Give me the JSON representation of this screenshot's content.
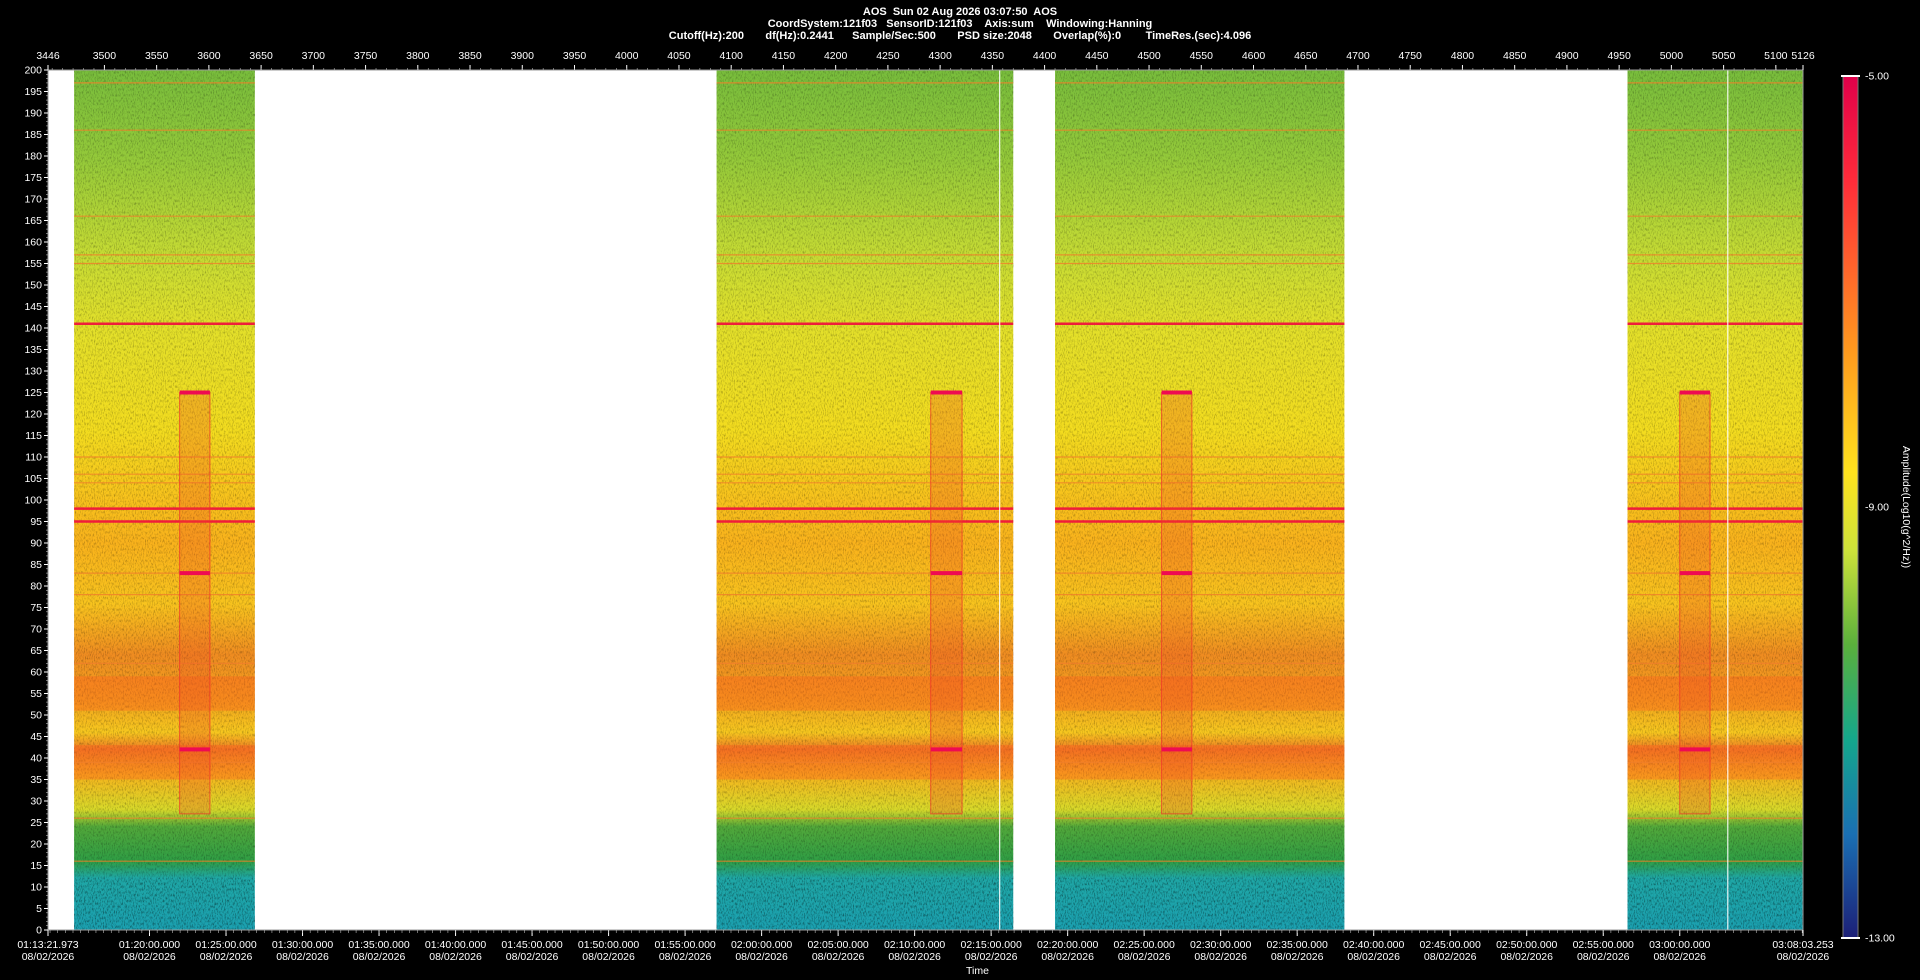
{
  "header": {
    "line1": "AOS  Sun 02 Aug 2026 03:07:50  AOS",
    "line2": "CoordSystem:121f03   SensorID:121f03    Axis:sum    Windowing:Hanning",
    "line3": "Cutoff(Hz):200       df(Hz):0.2441      Sample/Sec:500       PSD size:2048       Overlap(%):0        TimeRes.(sec):4.096"
  },
  "chart_data": {
    "type": "heatmap",
    "title": "",
    "ylabel": "",
    "xlabel": "Time",
    "colorbar_label": "Amplitude(Log10(g^2/Hz))",
    "colorbar_ticks": [
      "-5.00",
      "-9.00",
      "-13.00"
    ],
    "colorbar_range": [
      -13,
      -5
    ],
    "frequency_range": [
      0,
      200
    ],
    "y_ticks": [
      0,
      5,
      10,
      15,
      20,
      25,
      30,
      35,
      40,
      45,
      50,
      55,
      60,
      65,
      70,
      75,
      80,
      85,
      90,
      95,
      100,
      105,
      110,
      115,
      120,
      125,
      130,
      135,
      140,
      145,
      150,
      155,
      160,
      165,
      170,
      175,
      180,
      185,
      190,
      195,
      200
    ],
    "sample_axis_range": [
      3446,
      5126
    ],
    "sample_ticks": [
      "3446",
      "3500",
      "3550",
      "3600",
      "3650",
      "3700",
      "3750",
      "3800",
      "3850",
      "3900",
      "3950",
      "4000",
      "4050",
      "4100",
      "4150",
      "4200",
      "4250",
      "4300",
      "4350",
      "4400",
      "4450",
      "4500",
      "4550",
      "4600",
      "4650",
      "4700",
      "4750",
      "4800",
      "4850",
      "4900",
      "4950",
      "5000",
      "5050",
      "5100",
      "5126"
    ],
    "time_ticks": [
      {
        "time": "01:13:21.973",
        "date": "08/02/2026"
      },
      {
        "time": "01:20:00.000",
        "date": "08/02/2026"
      },
      {
        "time": "01:25:00.000",
        "date": "08/02/2026"
      },
      {
        "time": "01:30:00.000",
        "date": "08/02/2026"
      },
      {
        "time": "01:35:00.000",
        "date": "08/02/2026"
      },
      {
        "time": "01:40:00.000",
        "date": "08/02/2026"
      },
      {
        "time": "01:45:00.000",
        "date": "08/02/2026"
      },
      {
        "time": "01:50:00.000",
        "date": "08/02/2026"
      },
      {
        "time": "01:55:00.000",
        "date": "08/02/2026"
      },
      {
        "time": "02:00:00.000",
        "date": "08/02/2026"
      },
      {
        "time": "02:05:00.000",
        "date": "08/02/2026"
      },
      {
        "time": "02:10:00.000",
        "date": "08/02/2026"
      },
      {
        "time": "02:15:00.000",
        "date": "08/02/2026"
      },
      {
        "time": "02:20:00.000",
        "date": "08/02/2026"
      },
      {
        "time": "02:25:00.000",
        "date": "08/02/2026"
      },
      {
        "time": "02:30:00.000",
        "date": "08/02/2026"
      },
      {
        "time": "02:35:00.000",
        "date": "08/02/2026"
      },
      {
        "time": "02:40:00.000",
        "date": "08/02/2026"
      },
      {
        "time": "02:45:00.000",
        "date": "08/02/2026"
      },
      {
        "time": "02:50:00.000",
        "date": "08/02/2026"
      },
      {
        "time": "02:55:00.000",
        "date": "08/02/2026"
      },
      {
        "time": "03:00:00.000",
        "date": "08/02/2026"
      },
      {
        "time": "03:08:03.253",
        "date": "08/02/2026"
      }
    ],
    "data_segments": [
      {
        "start": 3471,
        "end": 3644
      },
      {
        "start": 4086,
        "end": 4370
      },
      {
        "start": 4410,
        "end": 4687
      },
      {
        "start": 4958,
        "end": 5133
      }
    ],
    "gap_color": "#ffffff",
    "events": [
      {
        "start": 3572,
        "end": 3601
      },
      {
        "start": 4291,
        "end": 4321
      },
      {
        "start": 4512,
        "end": 4541
      },
      {
        "start": 5008,
        "end": 5037
      }
    ],
    "event_band_hz": [
      27,
      125
    ],
    "event_hotspots_hz": [
      42,
      83,
      125
    ],
    "harmonic_lines_hz": [
      16,
      26,
      39,
      62,
      78,
      83,
      95,
      98,
      104,
      106,
      110,
      141,
      155,
      157,
      166,
      186,
      197
    ],
    "strong_lines_hz": [
      95,
      98,
      141
    ],
    "broadband_peaks_hz": [
      39,
      55
    ],
    "low_frequency_floor_hz": [
      0,
      12
    ],
    "vertical_markers": [
      4357,
      5054
    ]
  }
}
